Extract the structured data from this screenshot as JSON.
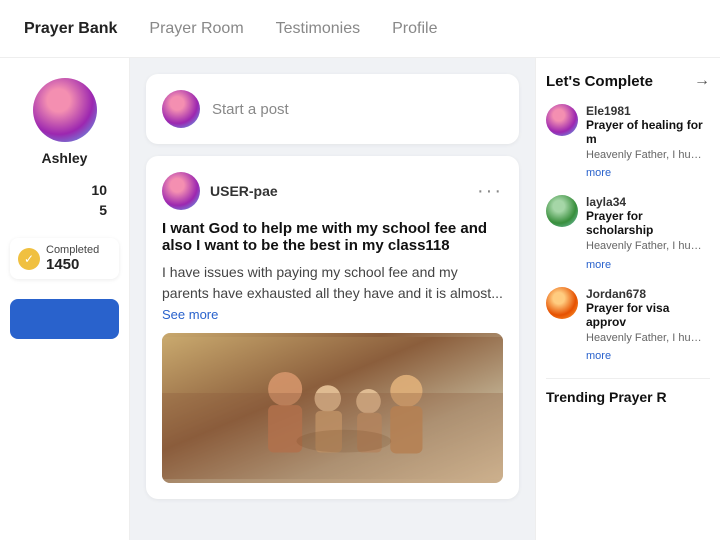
{
  "nav": {
    "items": [
      {
        "label": "Prayer Bank",
        "active": true
      },
      {
        "label": "Prayer Room",
        "active": false
      },
      {
        "label": "Testimonies",
        "active": false
      },
      {
        "label": "Profile",
        "active": false
      }
    ]
  },
  "sidebar": {
    "username": "Ashley",
    "stat1": {
      "number": "10",
      "label": ""
    },
    "stat2": {
      "number": "5",
      "label": ""
    },
    "completed_label": "Completed",
    "completed_count": "1450"
  },
  "feed": {
    "start_post_placeholder": "Start a post",
    "post": {
      "username": "USER-pae",
      "title": "I want God to help me with my school fee and also I want to be the best in my class118",
      "body": "I have issues with paying my school fee and my parents have exhausted all they have and it is almost...",
      "see_more": "See more"
    }
  },
  "right_sidebar": {
    "header": "Let's Complete",
    "arrow": "→",
    "prayers": [
      {
        "username": "Ele1981",
        "title": "Prayer of healing for m",
        "text": "Heavenly Father, I humbly as my beloved mum. Grant her s",
        "more": "more"
      },
      {
        "username": "layla34",
        "title": "Prayer for scholarship",
        "text": "Heavenly Father, I humbly as my beloved mum. Grant her s",
        "more": "more"
      },
      {
        "username": "Jordan678",
        "title": "Prayer for visa approv",
        "text": "Heavenly Father, I humbly as my beloved mum. Grant her s",
        "more": "more"
      }
    ],
    "trending_label": "Trending Prayer R"
  }
}
